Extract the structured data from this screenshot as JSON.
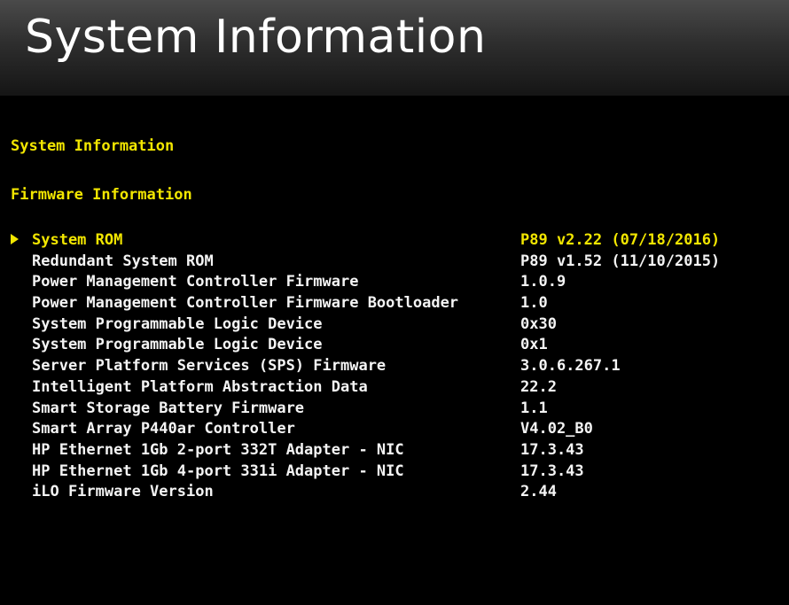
{
  "window": {
    "title": "System Information"
  },
  "sections": {
    "system_info_heading": "System Information",
    "firmware_info_heading": "Firmware Information"
  },
  "firmware": {
    "selected_index": 0,
    "items": [
      {
        "label": "System ROM",
        "value": "P89 v2.22 (07/18/2016)"
      },
      {
        "label": "Redundant System ROM",
        "value": "P89 v1.52 (11/10/2015)"
      },
      {
        "label": "Power Management Controller Firmware",
        "value": "1.0.9"
      },
      {
        "label": "Power Management Controller Firmware Bootloader",
        "value": "1.0"
      },
      {
        "label": "System Programmable Logic Device",
        "value": "0x30"
      },
      {
        "label": "System Programmable Logic Device",
        "value": "0x1"
      },
      {
        "label": "Server Platform Services (SPS) Firmware",
        "value": "3.0.6.267.1"
      },
      {
        "label": "Intelligent Platform Abstraction Data",
        "value": "22.2"
      },
      {
        "label": "Smart Storage Battery Firmware",
        "value": "1.1"
      },
      {
        "label": "Smart Array P440ar Controller",
        "value": "V4.02_B0"
      },
      {
        "label": "HP Ethernet 1Gb 2-port 332T Adapter - NIC",
        "value": "17.3.43"
      },
      {
        "label": "HP Ethernet 1Gb 4-port 331i Adapter - NIC",
        "value": "17.3.43"
      },
      {
        "label": "iLO Firmware Version",
        "value": "2.44"
      }
    ]
  },
  "colors": {
    "background": "#000000",
    "highlight": "#f2e600",
    "text": "#f4f4f4"
  },
  "icons": {
    "selection": "pointer-arrow-icon"
  }
}
